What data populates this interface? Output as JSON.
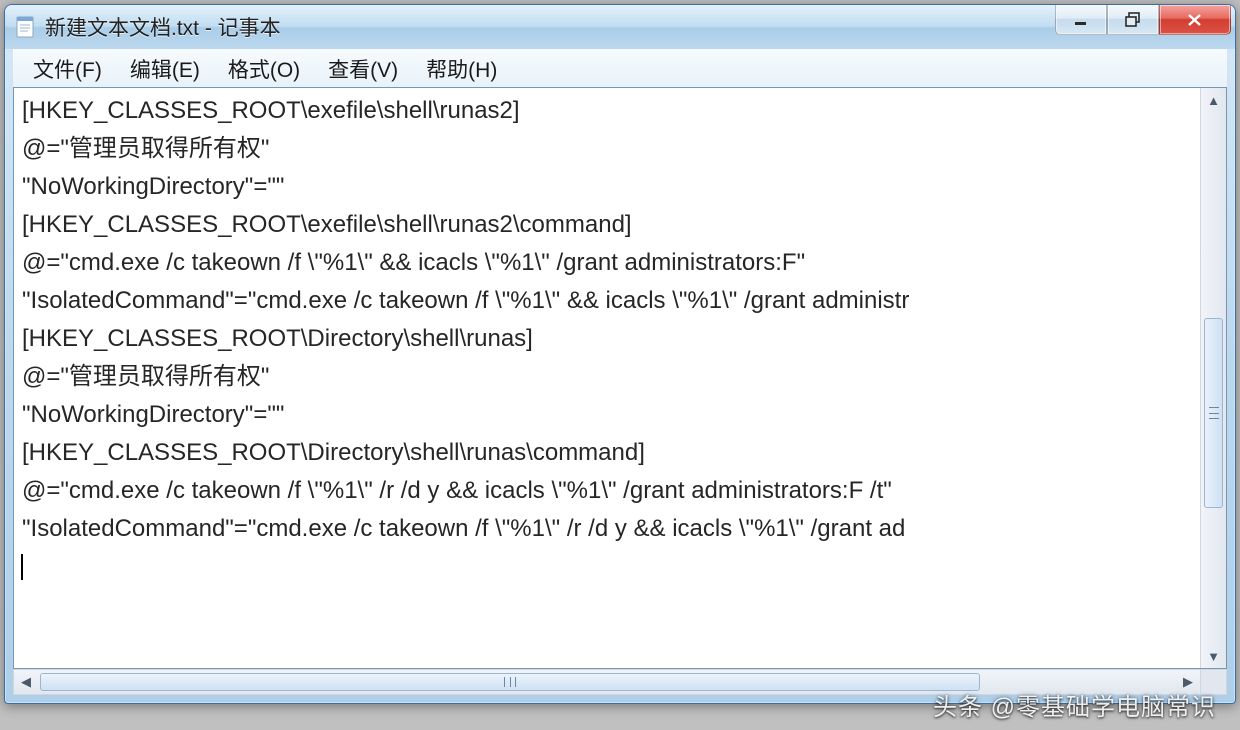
{
  "title": "新建文本文档.txt - 记事本",
  "menus": {
    "file": "文件(F)",
    "edit": "编辑(E)",
    "format": "格式(O)",
    "view": "查看(V)",
    "help": "帮助(H)"
  },
  "content_lines": [
    "[HKEY_CLASSES_ROOT\\exefile\\shell\\runas2]",
    "@=\"管理员取得所有权\"",
    "\"NoWorkingDirectory\"=\"\"",
    "[HKEY_CLASSES_ROOT\\exefile\\shell\\runas2\\command]",
    "@=\"cmd.exe /c takeown /f \\\"%1\\\" && icacls \\\"%1\\\" /grant administrators:F\"",
    "\"IsolatedCommand\"=\"cmd.exe /c takeown /f \\\"%1\\\" && icacls \\\"%1\\\" /grant administr",
    "[HKEY_CLASSES_ROOT\\Directory\\shell\\runas]",
    "@=\"管理员取得所有权\"",
    "\"NoWorkingDirectory\"=\"\"",
    "[HKEY_CLASSES_ROOT\\Directory\\shell\\runas\\command]",
    "@=\"cmd.exe /c takeown /f \\\"%1\\\" /r /d y && icacls \\\"%1\\\" /grant administrators:F /t\"",
    "\"IsolatedCommand\"=\"cmd.exe /c takeown /f \\\"%1\\\" /r /d y && icacls \\\"%1\\\" /grant ad"
  ],
  "watermark": "头条 @零基础学电脑常识"
}
